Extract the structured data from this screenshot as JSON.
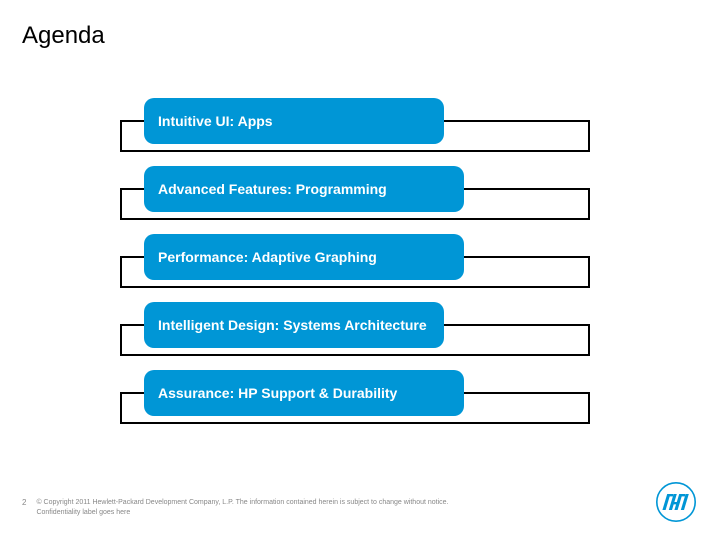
{
  "title": "Agenda",
  "items": [
    {
      "label": "Intuitive UI: Apps"
    },
    {
      "label": "Advanced Features: Programming"
    },
    {
      "label": "Performance: Adaptive Graphing"
    },
    {
      "label": "Intelligent Design: Systems Architecture"
    },
    {
      "label": "Assurance: HP Support & Durability"
    }
  ],
  "footer": {
    "page": "2",
    "copyright": "© Copyright 2011 Hewlett-Packard Development Company, L.P. The information contained herein is subject to change without notice. Confidentiality label goes here"
  },
  "colors": {
    "accent": "#0096d6"
  }
}
